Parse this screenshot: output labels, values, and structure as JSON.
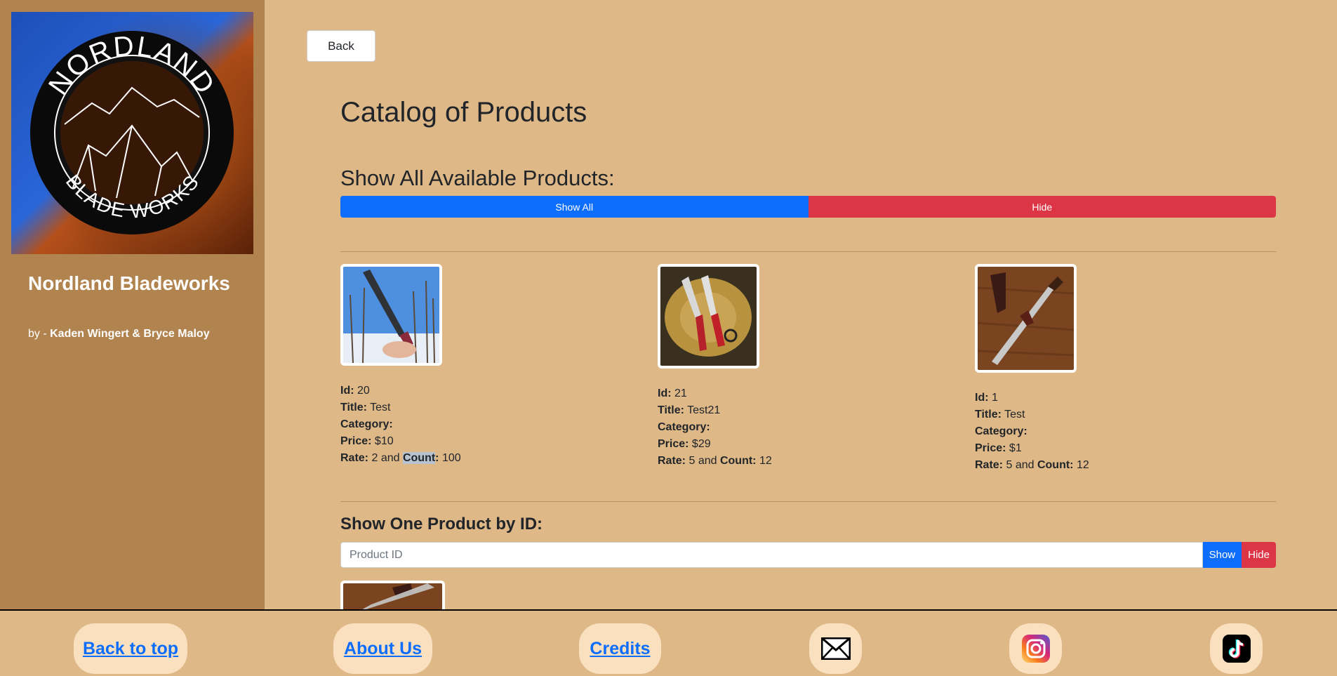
{
  "sidebar": {
    "logo_text_top": "NORDLAND",
    "logo_text_bottom": "BLADE WORKS",
    "brand_name": "Nordland Bladeworks",
    "byline_prefix": "by - ",
    "authors": "Kaden Wingert & Bryce Maloy"
  },
  "main": {
    "back_label": "Back",
    "page_title": "Catalog of Products",
    "show_all_heading": "Show All Available Products:",
    "show_all_label": "Show All",
    "hide_label": "Hide",
    "products": [
      {
        "id": "20",
        "title": "Test",
        "category": "",
        "price": "$10",
        "rate": "2",
        "count": "100"
      },
      {
        "id": "21",
        "title": "Test21",
        "category": "",
        "price": "$29",
        "rate": "5",
        "count": "12"
      },
      {
        "id": "1",
        "title": "Test",
        "category": "",
        "price": "$1",
        "rate": "5",
        "count": "12"
      }
    ],
    "labels": {
      "id": "Id:",
      "title": "Title:",
      "category": "Category:",
      "price": "Price:",
      "rate": "Rate:",
      "and": " and ",
      "count": "Count",
      "colon": ":"
    },
    "show_one_heading": "Show One Product by ID:",
    "product_id_placeholder": "Product ID",
    "show_label": "Show",
    "hide_one_label": "Hide"
  },
  "footer": {
    "back_to_top": "Back to top",
    "about_us": "About Us",
    "credits": "Credits",
    "icons": [
      "mail-icon",
      "instagram-icon",
      "tiktok-icon"
    ]
  },
  "colors": {
    "page_bg": "#deb887",
    "sidebar_bg": "#b0834f",
    "primary": "#0d6efd",
    "danger": "#dc3545",
    "pill_bg": "#fbe0c0"
  }
}
